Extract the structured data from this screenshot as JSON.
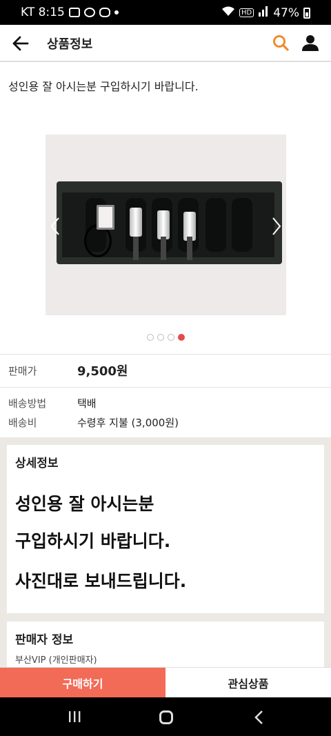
{
  "status_bar": {
    "carrier_time": "KT 8:15",
    "battery": "47%"
  },
  "header": {
    "title": "상품정보"
  },
  "intro": "성인용 잘 아시는분 구입하시기 바랍니다.",
  "carousel": {
    "total": 4,
    "active_index": 3
  },
  "price": {
    "label": "판매가",
    "value": "9,500원"
  },
  "shipping": {
    "method_label": "배송방법",
    "method_value": "택배",
    "fee_label": "배송비",
    "fee_value": "수령후 지불 (3,000원)"
  },
  "detail": {
    "title": "상세정보",
    "lines": [
      "성인용 잘 아시는분",
      "구입하시기 바랍니다.",
      "사진대로 보내드립니다."
    ]
  },
  "seller": {
    "title": "판매자 정보",
    "name": "부산VIP (개인판매자)"
  },
  "bottom_bar": {
    "buy_label": "구매하기",
    "wish_label": "관심상품"
  },
  "colors": {
    "accent": "#f26b57",
    "search": "#f08a2c",
    "dot_active": "#e84a4a"
  }
}
